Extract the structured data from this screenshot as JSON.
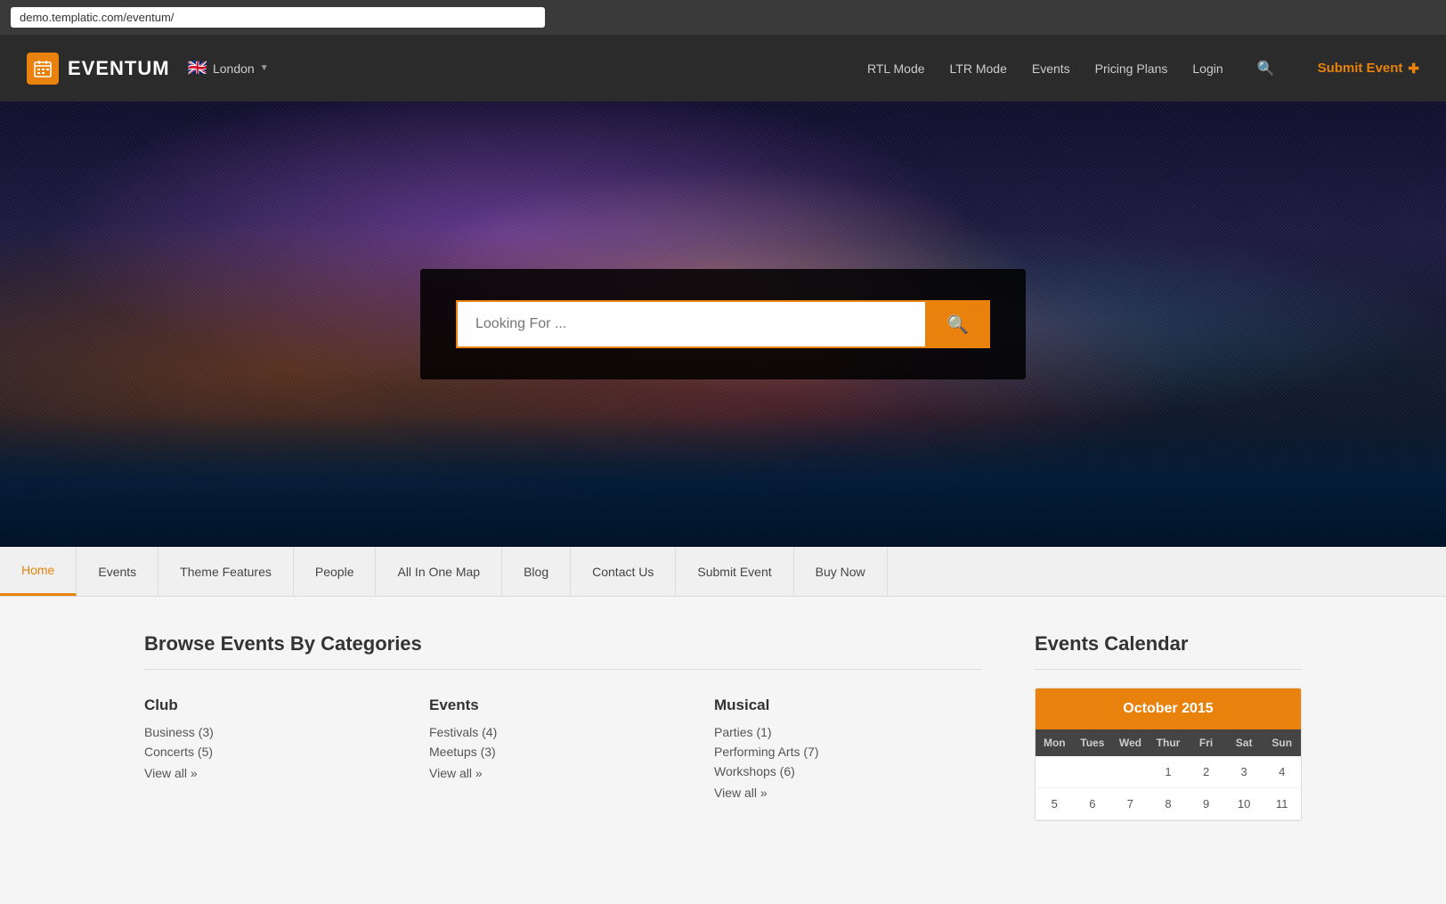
{
  "browser": {
    "url": "demo.templatic.com/eventum/"
  },
  "topnav": {
    "logo_text": "EVENTUM",
    "location": "London",
    "links": [
      {
        "label": "RTL Mode",
        "id": "rtl-mode"
      },
      {
        "label": "LTR Mode",
        "id": "ltr-mode"
      },
      {
        "label": "Events",
        "id": "events"
      },
      {
        "label": "Pricing Plans",
        "id": "pricing-plans"
      },
      {
        "label": "Login",
        "id": "login"
      }
    ],
    "submit_event": "Submit Event"
  },
  "hero": {
    "search_placeholder": "Looking For ..."
  },
  "secondarynav": {
    "items": [
      {
        "label": "Home",
        "active": true
      },
      {
        "label": "Events"
      },
      {
        "label": "Theme Features"
      },
      {
        "label": "People"
      },
      {
        "label": "All In One Map"
      },
      {
        "label": "Blog"
      },
      {
        "label": "Contact Us"
      },
      {
        "label": "Submit Event"
      },
      {
        "label": "Buy Now"
      }
    ]
  },
  "browse": {
    "title": "Browse Events By Categories",
    "categories": [
      {
        "name": "Club",
        "links": [
          {
            "label": "Business (3)"
          },
          {
            "label": "Concerts (5)"
          },
          {
            "label": "View all »"
          }
        ]
      },
      {
        "name": "Events",
        "links": [
          {
            "label": "Festivals (4)"
          },
          {
            "label": "Meetups (3)"
          },
          {
            "label": "View all »"
          }
        ]
      },
      {
        "name": "Musical",
        "links": [
          {
            "label": "Parties (1)"
          },
          {
            "label": "Performing Arts (7)"
          },
          {
            "label": "Workshops (6)"
          },
          {
            "label": "View all »"
          }
        ]
      }
    ]
  },
  "calendar": {
    "title": "Events Calendar",
    "month_label": "October 2015",
    "day_names": [
      "Mon",
      "Tues",
      "Wed",
      "Thur",
      "Fri",
      "Sat",
      "Sun"
    ],
    "days": [
      "",
      "",
      "",
      "1",
      "2",
      "3",
      "4",
      "5",
      "6",
      "7",
      "8",
      "9",
      "10",
      "11"
    ]
  }
}
